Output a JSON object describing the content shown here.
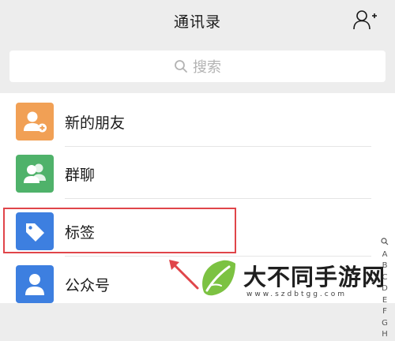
{
  "header": {
    "title": "通讯录",
    "add_icon": "add-contact-icon"
  },
  "search": {
    "placeholder": "搜索",
    "icon": "search-icon"
  },
  "list": {
    "items": [
      {
        "label": "新的朋友",
        "icon": "new-friend-icon",
        "color": "#f1a055"
      },
      {
        "label": "群聊",
        "icon": "group-chat-icon",
        "color": "#4fb26a"
      },
      {
        "label": "标签",
        "icon": "tag-icon",
        "color": "#3d7fe0"
      },
      {
        "label": "公众号",
        "icon": "official-account-icon",
        "color": "#3d7fe0"
      }
    ]
  },
  "index_bar": {
    "letters": [
      "Q",
      "A",
      "B",
      "C",
      "D",
      "E",
      "F",
      "G",
      "H"
    ]
  },
  "annotation": {
    "highlight_color": "#e0454a"
  },
  "watermark": {
    "text": "大不同手游网",
    "url": "www.szdbtgg.com",
    "logo_icon": "leaf-logo-icon"
  }
}
